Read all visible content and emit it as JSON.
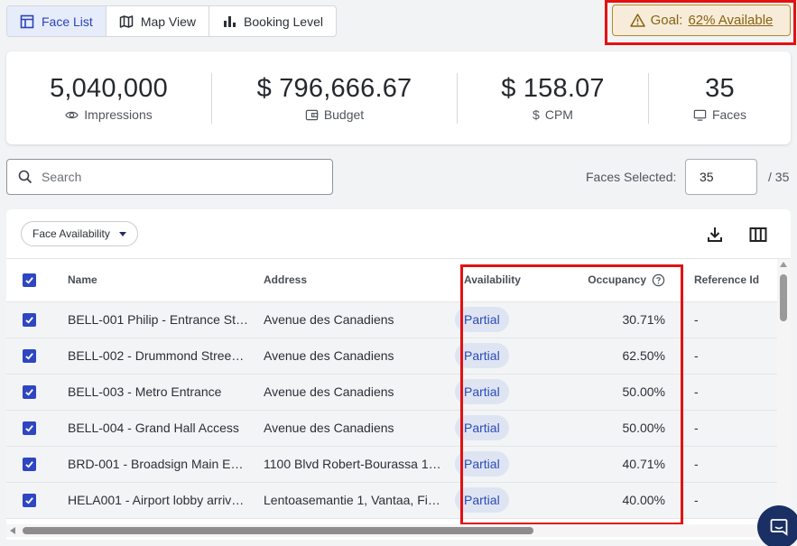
{
  "tabs": [
    {
      "label": "Face List",
      "icon": "table-icon",
      "active": true
    },
    {
      "label": "Map View",
      "icon": "map-icon",
      "active": false
    },
    {
      "label": "Booking Level",
      "icon": "bar-chart-icon",
      "active": false
    }
  ],
  "goal": {
    "prefix": "Goal:",
    "value": "62% Available",
    "icon": "warning-icon",
    "color": "#8a6212"
  },
  "stats": [
    {
      "value": "5,040,000",
      "label": "Impressions",
      "icon": "eye-icon"
    },
    {
      "value": "$ 796,666.67",
      "label": "Budget",
      "icon": "wallet-icon"
    },
    {
      "value": "$ 158.07",
      "label": "CPM",
      "icon": "dollar-icon"
    },
    {
      "value": "35",
      "label": "Faces",
      "icon": "monitor-icon"
    }
  ],
  "search": {
    "placeholder": "Search"
  },
  "faces_selected": {
    "label": "Faces Selected:",
    "value": "35",
    "total": "/ 35"
  },
  "toolbar": {
    "filter_label": "Face Availability"
  },
  "columns": {
    "name": "Name",
    "address": "Address",
    "availability": "Availability",
    "occupancy": "Occupancy",
    "reference": "Reference Id"
  },
  "rows": [
    {
      "name": "BELL-001 Philip - Entrance St…",
      "address": "Avenue des Canadiens",
      "availability": "Partial",
      "occupancy": "30.71%",
      "reference": "-"
    },
    {
      "name": "BELL-002 - Drummond Stree…",
      "address": "Avenue des Canadiens",
      "availability": "Partial",
      "occupancy": "62.50%",
      "reference": "-"
    },
    {
      "name": "BELL-003 - Metro Entrance",
      "address": "Avenue des Canadiens",
      "availability": "Partial",
      "occupancy": "50.00%",
      "reference": "-"
    },
    {
      "name": "BELL-004 - Grand Hall Access",
      "address": "Avenue des Canadiens",
      "availability": "Partial",
      "occupancy": "50.00%",
      "reference": "-"
    },
    {
      "name": "BRD-001 - Broadsign Main E…",
      "address": "1100 Blvd Robert-Bourassa 1…",
      "availability": "Partial",
      "occupancy": "40.71%",
      "reference": "-"
    },
    {
      "name": "HELA001 - Airport lobby arriv…",
      "address": "Lentoasemantie 1, Vantaa, Fi…",
      "availability": "Partial",
      "occupancy": "40.00%",
      "reference": "-"
    }
  ],
  "colors": {
    "accent": "#2e46c2",
    "highlight": "#e41111",
    "pill_bg": "#dfe4f2",
    "occupancy_text": "#2b5fd6"
  }
}
